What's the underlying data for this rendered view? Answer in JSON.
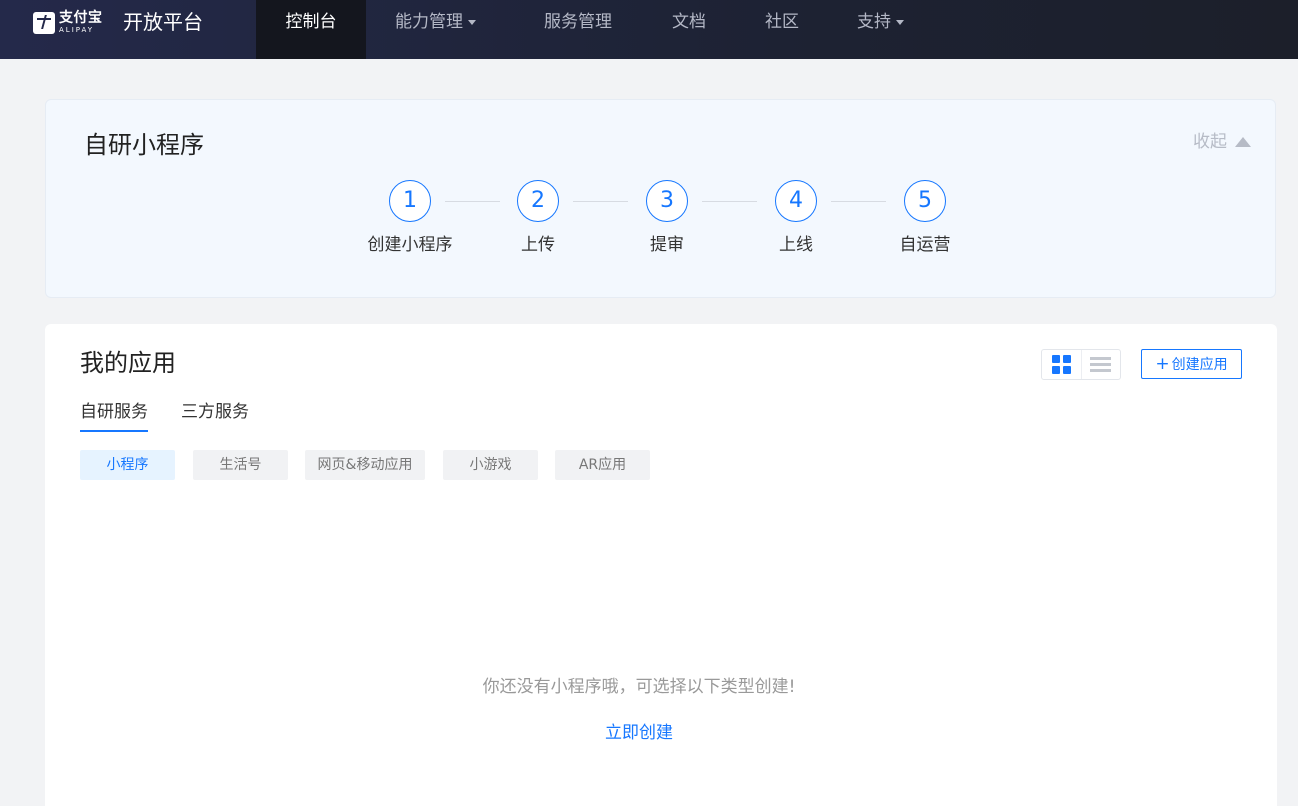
{
  "header": {
    "logo_cn": "支付宝",
    "logo_en": "ALIPAY",
    "platform_title": "开放平台",
    "nav": [
      {
        "label": "控制台"
      },
      {
        "label": "能力管理"
      },
      {
        "label": "服务管理"
      },
      {
        "label": "文档"
      },
      {
        "label": "社区"
      },
      {
        "label": "支持"
      }
    ]
  },
  "steps_card": {
    "title": "自研小程序",
    "collapse_label": "收起",
    "steps": [
      {
        "num": "1",
        "label": "创建小程序"
      },
      {
        "num": "2",
        "label": "上传"
      },
      {
        "num": "3",
        "label": "提审"
      },
      {
        "num": "4",
        "label": "上线"
      },
      {
        "num": "5",
        "label": "自运营"
      }
    ]
  },
  "apps_card": {
    "title": "我的应用",
    "create_button": "创建应用",
    "create_icon": "+",
    "tabs": [
      {
        "label": "自研服务"
      },
      {
        "label": "三方服务"
      }
    ],
    "categories": [
      {
        "label": "小程序"
      },
      {
        "label": "生活号"
      },
      {
        "label": "网页&移动应用"
      },
      {
        "label": "小游戏"
      },
      {
        "label": "AR应用"
      }
    ],
    "empty_message": "你还没有小程序哦，可选择以下类型创建!",
    "create_now": "立即创建"
  },
  "colors": {
    "accent": "#1677ff",
    "nav_bg": "#1d2233",
    "page_bg": "#f2f3f5"
  }
}
